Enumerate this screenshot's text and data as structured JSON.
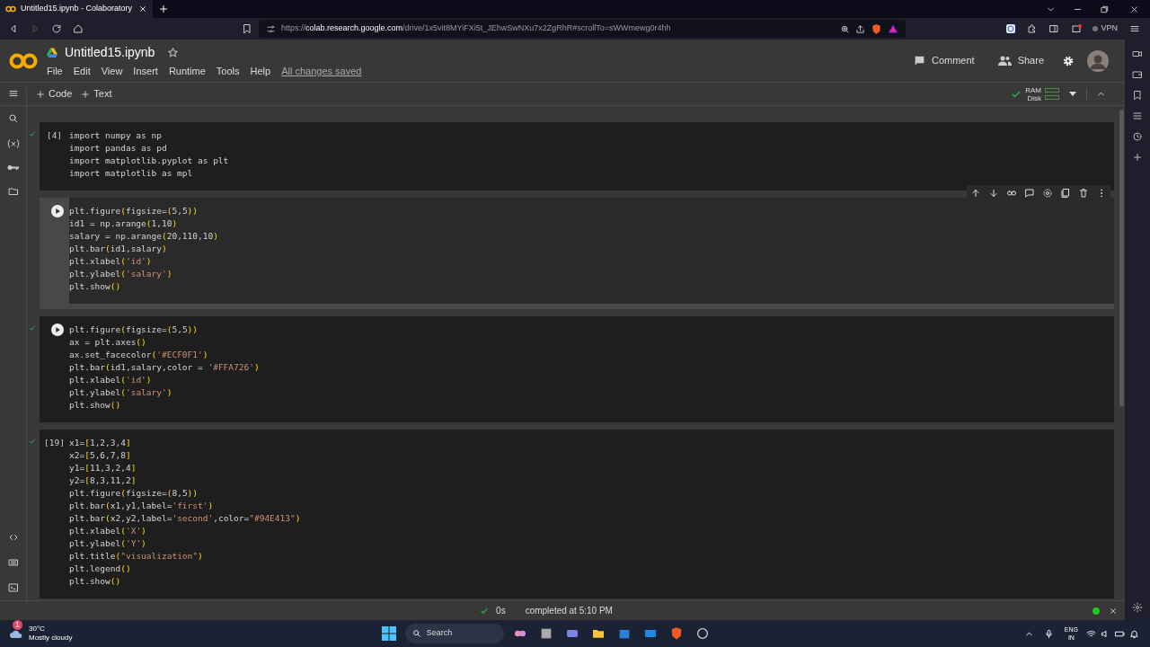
{
  "browser": {
    "tab_title": "Untitled15.ipynb - Colaboratory",
    "url": "https://**colab.research.google.com**/drive/1x5vit8MYiFXi5t_JEhwSwNXu7x2ZgRhR#scrollTo=sWWmewg0r4hh",
    "vpn": "VPN"
  },
  "notebook": {
    "title": "Untitled15.ipynb",
    "menu": [
      "File",
      "Edit",
      "View",
      "Insert",
      "Runtime",
      "Tools",
      "Help"
    ],
    "save_status": "All changes saved",
    "comment": "Comment",
    "share": "Share"
  },
  "toolbar": {
    "add": [
      "Code",
      "Text"
    ],
    "ram": "RAM",
    "disk": "Disk"
  },
  "cells": [
    {
      "count": "[4]",
      "ran": true,
      "selected": false,
      "lines": [
        "import numpy as np",
        "import pandas as pd",
        "import matplotlib.pyplot as plt",
        "import matplotlib as mpl"
      ]
    },
    {
      "ran": false,
      "selected": true,
      "lines": [
        "plt.figure(figsize=(5,5))",
        "id1 = np.arange(1,10)",
        "salary = np.arange(20,110,10)",
        "plt.bar(id1,salary)",
        "plt.xlabel('id')",
        "plt.ylabel('salary')",
        "plt.show()"
      ]
    },
    {
      "ran": true,
      "selected": false,
      "lines": [
        "plt.figure(figsize=(5,5))",
        "ax = plt.axes()",
        "ax.set_facecolor('#ECF0F1')",
        "plt.bar(id1,salary,color = '#FFA726')",
        "plt.xlabel('id')",
        "plt.ylabel('salary')",
        "plt.show()"
      ]
    },
    {
      "count": "[19]",
      "ran": true,
      "selected": false,
      "lines": [
        "x1=[1,2,3,4]",
        "x2=[5,6,7,8]",
        "y1=[11,3,2,4]",
        "y2=[8,3,11,2]",
        "plt.figure(figsize=(8,5))",
        "plt.bar(x1,y1,label='first')",
        "plt.bar(x2,y2,label='second',color=\"#94E413\")",
        "plt.xlabel('X')",
        "plt.ylabel('Y')",
        "plt.title(\"visualization\")",
        "plt.legend()",
        "plt.show()"
      ]
    }
  ],
  "status_bar": {
    "duration": "0s",
    "message": "completed at 5:10 PM"
  },
  "taskbar": {
    "temperature": "30°C",
    "weather": "Mostly cloudy",
    "weather_badge": "1",
    "search": "Search",
    "language": "ENG",
    "region": "IN"
  }
}
